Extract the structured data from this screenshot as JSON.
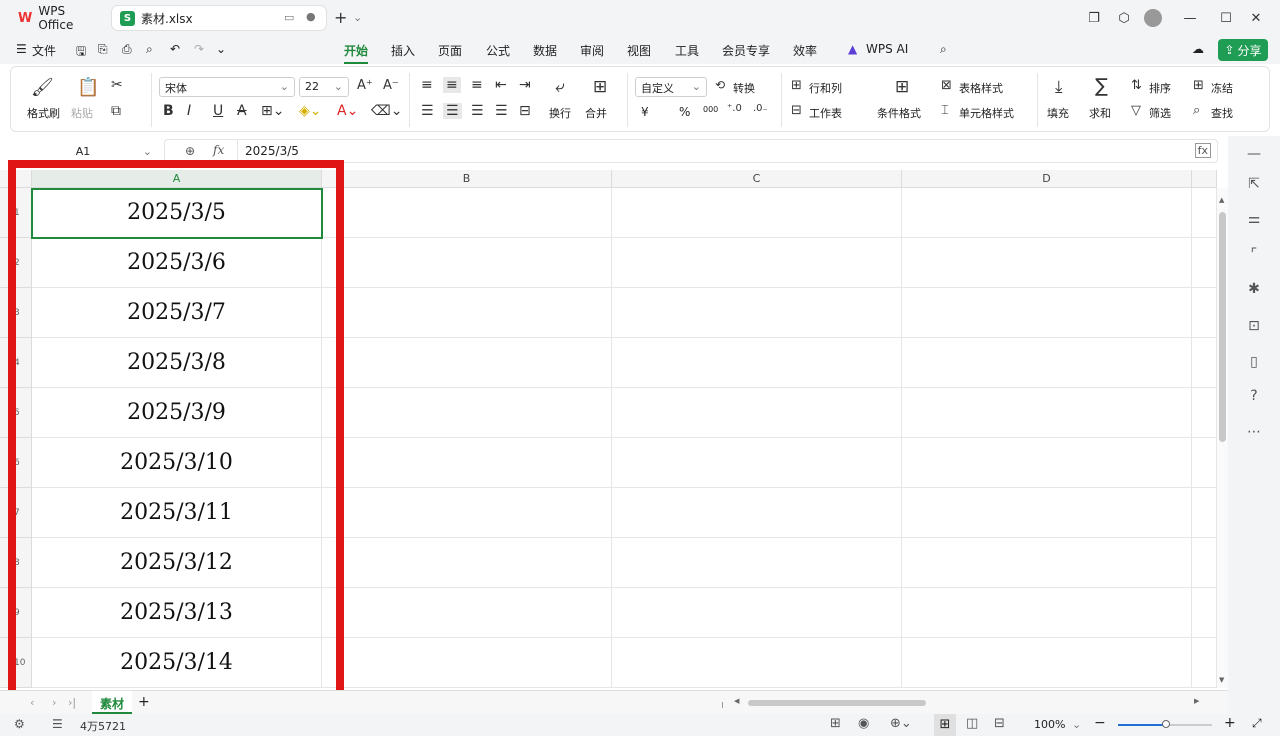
{
  "titlebar": {
    "app_tab": "WPS Office",
    "file_tab": "素材.xlsx",
    "file_badge": "S"
  },
  "menu": {
    "file": "文件",
    "tabs": [
      "开始",
      "插入",
      "页面",
      "公式",
      "数据",
      "审阅",
      "视图",
      "工具",
      "会员专享",
      "效率",
      "WPS AI"
    ],
    "active_tab": "开始",
    "share": "分享"
  },
  "ribbon": {
    "format_painter": "格式刷",
    "paste": "粘贴",
    "font_name": "宋体",
    "font_size": "22",
    "wrap": "换行",
    "merge": "合并",
    "number_format": "自定义",
    "convert": "转换",
    "row_col": "行和列",
    "worksheet": "工作表",
    "cond_format": "条件格式",
    "table_style": "表格样式",
    "cell_style": "单元格样式",
    "fill": "填充",
    "sum": "求和",
    "sort": "排序",
    "filter": "筛选",
    "freeze": "冻结",
    "find": "查找",
    "currency": "¥",
    "percent": "%",
    "thousands": "000"
  },
  "formula": {
    "cell_ref": "A1",
    "fx": "fx",
    "value": "2025/3/5"
  },
  "columns": [
    "A",
    "B",
    "C",
    "D"
  ],
  "rows": [
    {
      "num": "1",
      "a": "2025/3/5"
    },
    {
      "num": "2",
      "a": "2025/3/6"
    },
    {
      "num": "3",
      "a": "2025/3/7"
    },
    {
      "num": "4",
      "a": "2025/3/8"
    },
    {
      "num": "5",
      "a": "2025/3/9"
    },
    {
      "num": "6",
      "a": "2025/3/10"
    },
    {
      "num": "7",
      "a": "2025/3/11"
    },
    {
      "num": "8",
      "a": "2025/3/12"
    },
    {
      "num": "9",
      "a": "2025/3/13"
    },
    {
      "num": "10",
      "a": "2025/3/14"
    }
  ],
  "sheet": {
    "name": "素材",
    "add": "+"
  },
  "status": {
    "count": "4万5721",
    "zoom": "100%"
  },
  "colors": {
    "accent": "#1f8a3b",
    "highlight_box": "#e01515"
  }
}
